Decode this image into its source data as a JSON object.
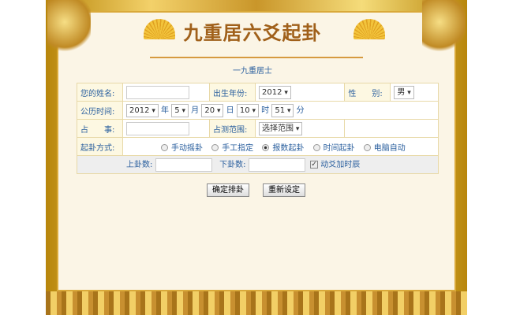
{
  "title": "九重居六爻起卦",
  "subtitle": "一九重居士",
  "form": {
    "name_label": "您的姓名:",
    "birth_year_label": "出生年份:",
    "birth_year": "2012",
    "gender_label": "性　　别:",
    "gender": "男",
    "time_label": "公历时间:",
    "year": "2012",
    "year_unit": "年",
    "month": "5",
    "month_unit": "月",
    "day": "20",
    "day_unit": "日",
    "hour": "10",
    "hour_unit": "时",
    "minute": "51",
    "minute_unit": "分",
    "matter_label": "占　　事:",
    "range_label": "占测范围:",
    "range": "选择范围",
    "method_label": "起卦方式:",
    "methods": [
      "手动摇卦",
      "手工指定",
      "报数起卦",
      "时间起卦",
      "电脑自动"
    ],
    "selected_method": "报数起卦",
    "upper_label": "上卦数:",
    "lower_label": "下卦数:",
    "moving_label": "动爻加时辰",
    "moving_checked": true
  },
  "buttons": {
    "submit": "确定排卦",
    "reset": "重新设定"
  }
}
